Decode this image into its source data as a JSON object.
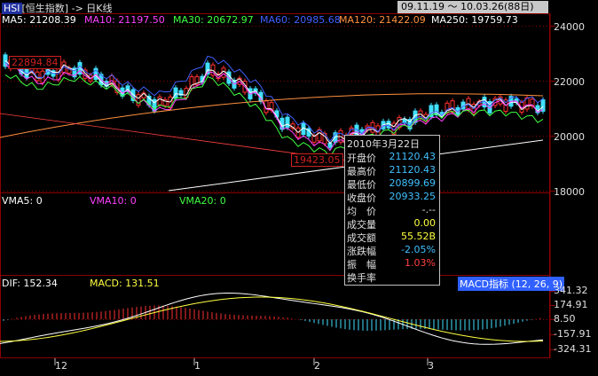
{
  "header": {
    "code": "HSI",
    "name": "[恒生指数]",
    "arrow": "->",
    "period": "日K线",
    "date_range": "09.11.19 ～ 10.03.26(88日)"
  },
  "ma_legend": [
    {
      "label": "MA5: 21208.39",
      "color": "#ffffff"
    },
    {
      "label": "MA10: 21197.50",
      "color": "#ff40ff"
    },
    {
      "label": "MA30: 20672.97",
      "color": "#40ff40"
    },
    {
      "label": "MA60: 20985.68",
      "color": "#4060ff"
    },
    {
      "label": "MA120: 21422.09",
      "color": "#ff9040"
    },
    {
      "label": "MA250: 19759.73",
      "color": "#ffffff"
    }
  ],
  "price_axis": [
    "24000",
    "22000",
    "20000",
    "18000"
  ],
  "high_marker": "22894.84",
  "low_marker": "19423.05",
  "tooltip": {
    "date": "2010年3月22日",
    "rows": [
      {
        "key": "开盘价",
        "value": "21120.43",
        "color": "#40c0ff"
      },
      {
        "key": "最高价",
        "value": "21120.43",
        "color": "#40c0ff"
      },
      {
        "key": "最低价",
        "value": "20899.69",
        "color": "#40c0ff"
      },
      {
        "key": "收盘价",
        "value": "20933.25",
        "color": "#40c0ff"
      },
      {
        "key": "均　价",
        "value": "-.--",
        "color": "#e0e0e0"
      },
      {
        "key": "成交量",
        "value": "0.00",
        "color": "#ffff40"
      },
      {
        "key": "成交额",
        "value": "55.52B",
        "color": "#ffff40"
      },
      {
        "key": "涨跌幅",
        "value": "-2.05%",
        "color": "#40c0ff"
      },
      {
        "key": "振　幅",
        "value": "1.03%",
        "color": "#ff4040"
      },
      {
        "key": "换手率",
        "value": "",
        "color": "#e0e0e0"
      }
    ]
  },
  "volume_legend": [
    {
      "label": "VMA5: 0",
      "color": "#ffffff"
    },
    {
      "label": "VMA10: 0",
      "color": "#ff40ff"
    },
    {
      "label": "VMA20: 0",
      "color": "#40ff40"
    }
  ],
  "macd_legend": [
    {
      "label": "DIF: 152.34",
      "color": "#ffffff"
    },
    {
      "label": "MACD: 131.51",
      "color": "#ffff40"
    }
  ],
  "macd_tag": "MACD指标 (12, 26, 9)",
  "macd_axis": [
    "341.32",
    "174.91",
    "8.50",
    "-157.91",
    "-324.31"
  ],
  "months": [
    "12",
    "1",
    "2",
    "3"
  ],
  "colors": {
    "up": "#ff3030",
    "down": "#40e0ff",
    "grid": "#8b0000",
    "background": "#000000"
  }
}
